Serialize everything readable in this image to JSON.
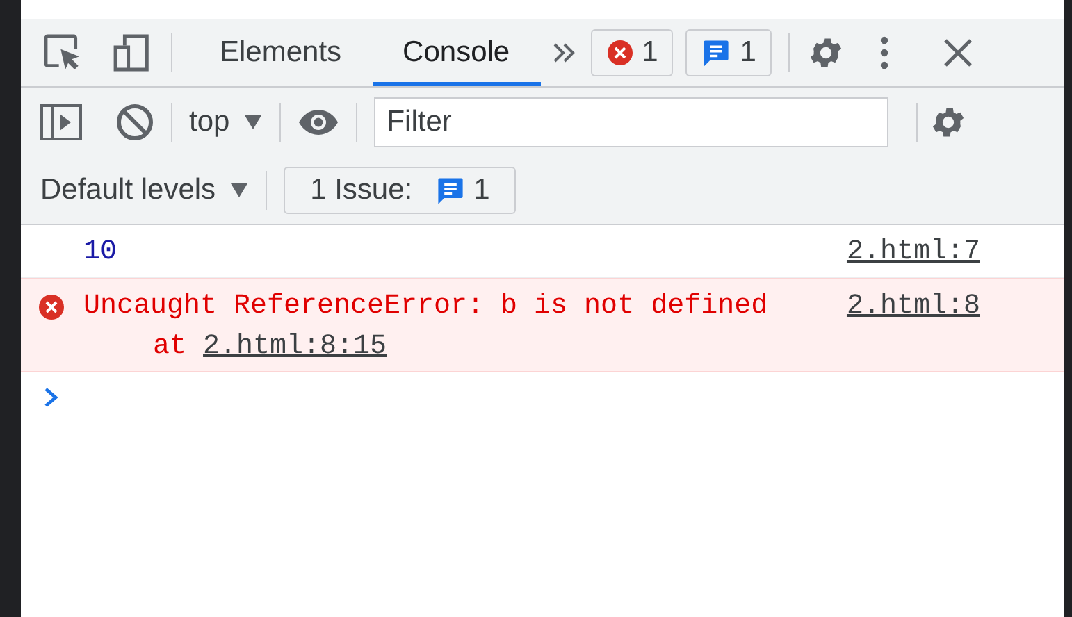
{
  "tabs": [
    {
      "label": "Elements",
      "selected": false
    },
    {
      "label": "Console",
      "selected": true
    }
  ],
  "error_count": "1",
  "message_count": "1",
  "console_toolbar": {
    "context": "top",
    "filter_placeholder": "Filter",
    "levels": "Default levels",
    "issues_label": "1 Issue:",
    "issues_count": "1"
  },
  "messages": [
    {
      "kind": "log",
      "text": "10",
      "source": "2.html:7"
    },
    {
      "kind": "error",
      "text": "Uncaught ReferenceError: b is not defined",
      "stack_prefix": "at",
      "stack_link": "2.html:8:15",
      "source": "2.html:8"
    }
  ]
}
